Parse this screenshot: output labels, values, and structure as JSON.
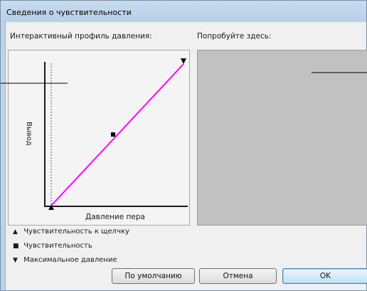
{
  "window": {
    "title": "Сведения о чувствительности"
  },
  "panels": {
    "profile_label": "Интерактивный профиль давления:",
    "try_label": "Попробуйте здесь:"
  },
  "graph": {
    "y_axis_label": "Вывод",
    "x_axis_label": "Давление пера"
  },
  "legend": {
    "items": [
      {
        "symbol": "▲",
        "label": "Чувствительность к щелчку"
      },
      {
        "symbol": "■",
        "label": "Чувствительность"
      },
      {
        "symbol": "▼",
        "label": "Максимальное давление"
      }
    ]
  },
  "buttons": {
    "default_label": "По умолчанию",
    "cancel_label": "Отмена",
    "ok_label": "OK"
  },
  "colors": {
    "curve": "#ff00ff",
    "dashed_line": "#4b4bd6",
    "try_area": "#c1c1c1"
  }
}
